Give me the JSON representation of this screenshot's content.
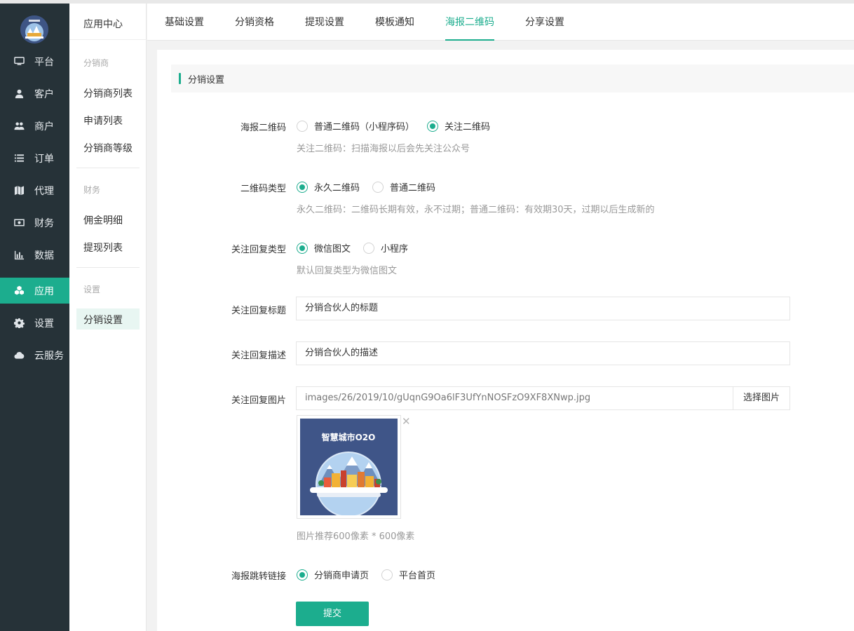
{
  "sidebar": {
    "items": [
      {
        "label": "平台",
        "icon": "monitor-icon"
      },
      {
        "label": "客户",
        "icon": "user-icon"
      },
      {
        "label": "商户",
        "icon": "users-icon"
      },
      {
        "label": "订单",
        "icon": "list-icon"
      },
      {
        "label": "代理",
        "icon": "map-icon"
      },
      {
        "label": "财务",
        "icon": "money-icon"
      },
      {
        "label": "数据",
        "icon": "bar-chart-icon"
      },
      {
        "label": "应用",
        "icon": "cubes-icon",
        "active": true
      },
      {
        "label": "设置",
        "icon": "gear-icon"
      },
      {
        "label": "云服务",
        "icon": "cloud-icon"
      }
    ],
    "active_color": "#1cad8e",
    "bg_color": "#263238"
  },
  "submenu": {
    "title": "应用中心",
    "group1": "分销商",
    "link1": "分销商列表",
    "link2": "申请列表",
    "link3": "分销商等级",
    "group2": "财务",
    "link4": "佣金明细",
    "link5": "提现列表",
    "group3": "设置",
    "link6": "分销设置"
  },
  "tabs": [
    "基础设置",
    "分销资格",
    "提现设置",
    "模板通知",
    "海报二维码",
    "分享设置"
  ],
  "active_tab": "海报二维码",
  "section": {
    "title": "分销设置"
  },
  "form": {
    "poster_qr": {
      "label": "海报二维码",
      "options": [
        "普通二维码（小程序码）",
        "关注二维码"
      ],
      "selected": "关注二维码",
      "hint": "关注二维码：扫描海报以后会先关注公众号"
    },
    "qr_type": {
      "label": "二维码类型",
      "options": [
        "永久二维码",
        "普通二维码"
      ],
      "selected": "永久二维码",
      "hint": "永久二维码：二维码长期有效，永不过期；普通二维码：有效期30天，过期以后生成新的"
    },
    "reply_type": {
      "label": "关注回复类型",
      "options": [
        "微信图文",
        "小程序"
      ],
      "selected": "微信图文",
      "hint": "默认回复类型为微信图文"
    },
    "reply_title": {
      "label": "关注回复标题",
      "value": "分销合伙人的标题"
    },
    "reply_desc": {
      "label": "关注回复描述",
      "value": "分销合伙人的描述"
    },
    "reply_image": {
      "label": "关注回复图片",
      "value": "images/26/2019/10/gUqnG9Oa6lF3UfYnNOSFzO9XF8XNwp.jpg",
      "button": "选择图片",
      "preview_text": "智慧城市O2O",
      "hint": "图片推荐600像素 * 600像素"
    },
    "jump_link": {
      "label": "海报跳转链接",
      "options": [
        "分销商申请页",
        "平台首页"
      ],
      "selected": "分销商申请页"
    },
    "submit": "提交"
  }
}
